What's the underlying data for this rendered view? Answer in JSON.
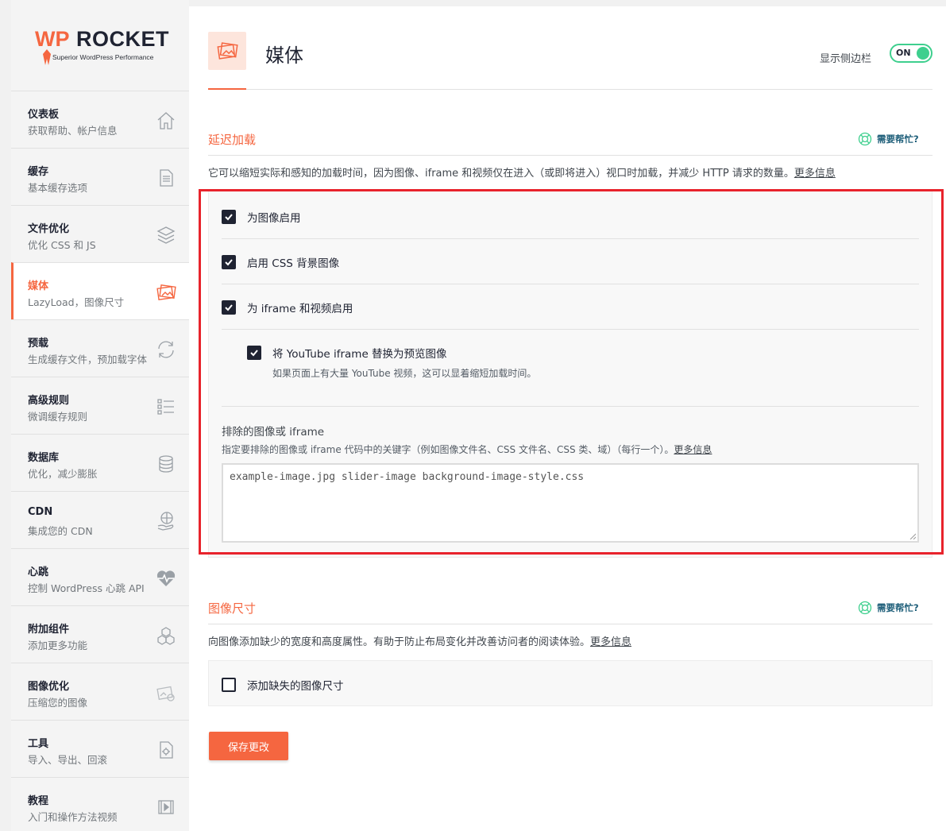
{
  "brand": {
    "wp": "WP",
    "rocket": "ROCKET",
    "tagline": "Superior WordPress Performance"
  },
  "sidebar": {
    "items": [
      {
        "title": "仪表板",
        "sub": "获取帮助、帐户信息",
        "icon": "home-icon"
      },
      {
        "title": "缓存",
        "sub": "基本缓存选项",
        "icon": "document-icon"
      },
      {
        "title": "文件优化",
        "sub": "优化 CSS 和 JS",
        "icon": "layers-icon"
      },
      {
        "title": "媒体",
        "sub": "LazyLoad，图像尺寸",
        "icon": "images-icon",
        "active": true
      },
      {
        "title": "预载",
        "sub": "生成缓存文件，预加载字体",
        "icon": "refresh-icon"
      },
      {
        "title": "高级规则",
        "sub": "微调缓存规则",
        "icon": "list-icon"
      },
      {
        "title": "数据库",
        "sub": "优化，减少膨胀",
        "icon": "database-icon"
      },
      {
        "title": "CDN",
        "sub": "集成您的 CDN",
        "icon": "globe-hand-icon"
      },
      {
        "title": "心跳",
        "sub": "控制 WordPress 心跳 API",
        "icon": "heartbeat-icon"
      },
      {
        "title": "附加组件",
        "sub": "添加更多功能",
        "icon": "cubes-icon"
      },
      {
        "title": "图像优化",
        "sub": "压缩您的图像",
        "icon": "image-optimize-icon"
      },
      {
        "title": "工具",
        "sub": "导入、导出、回滚",
        "icon": "tools-icon"
      },
      {
        "title": "教程",
        "sub": "入门和操作方法视频",
        "icon": "video-icon"
      }
    ]
  },
  "header": {
    "title": "媒体",
    "sidebar_toggle_label": "显示侧边栏",
    "toggle_state": "ON"
  },
  "lazyload": {
    "title": "延迟加载",
    "help": "需要帮忙?",
    "description": "它可以缩短实际和感知的加载时间，因为图像、iframe 和视频仅在进入（或即将进入）视口时加载，并减少 HTTP 请求的数量。",
    "more_info": "更多信息",
    "options": {
      "images": "为图像启用",
      "css_bg": "启用 CSS 背景图像",
      "iframes": "为 iframe 和视频启用",
      "youtube": "将 YouTube iframe 替换为预览图像",
      "youtube_desc": "如果页面上有大量 YouTube 视频，这可以显着缩短加载时间。"
    },
    "exclude": {
      "label": "排除的图像或 iframe",
      "description": "指定要排除的图像或 iframe 代码中的关键字（例如图像文件名、CSS 文件名、CSS 类、域）（每行一个）。",
      "more_info": "更多信息",
      "value": "example-image.jpg slider-image background-image-style.css"
    }
  },
  "image_dimensions": {
    "title": "图像尺寸",
    "help": "需要帮忙?",
    "description": "向图像添加缺少的宽度和高度属性。有助于防止布局变化并改善访问者的阅读体验。",
    "more_info": "更多信息",
    "option": "添加缺失的图像尺寸"
  },
  "save_label": "保存更改",
  "colors": {
    "accent": "#f56640",
    "toggle": "#3ecf8e",
    "dark": "#1f2332",
    "highlight": "#e8232c"
  }
}
